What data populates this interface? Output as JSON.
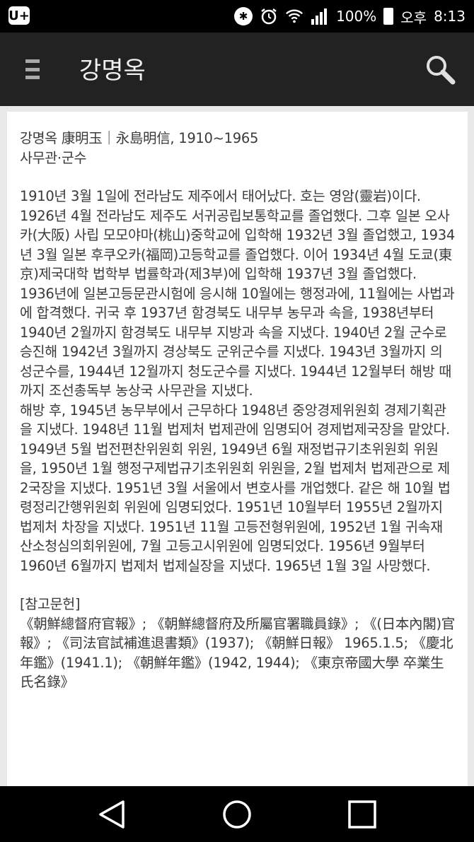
{
  "status_bar": {
    "app_badge": "U+",
    "battery": "100%",
    "ampm": "오후",
    "time": "8:13",
    "icons": [
      "bluetooth-icon",
      "alarm-icon",
      "wifi-icon",
      "signal-icon",
      "battery-icon"
    ]
  },
  "app_bar": {
    "title": "강명옥",
    "menu_icon": "hamburger-menu-icon",
    "search_icon": "search-icon",
    "background": "#222222"
  },
  "article": {
    "heading_line1": "강명옥 康明玉｜永島明信, 1910~1965",
    "heading_line2": "사무관·군수",
    "body_paragraph1": "1910년 3월 1일에 전라남도 제주에서 태어났다. 호는 영암(靈岩)이다. 1926년 4월 전라남도 제주도 서귀공립보통학교를 졸업했다. 그후 일본 오사카(大阪) 사립 모모야마(桃山)중학교에 입학해 1932년 3월 졸업했고, 1934년 3월 일본 후쿠오카(福岡)고등학교를 졸업했다. 이어 1934년 4월 도쿄(東京)제국대학 법학부 법률학과(제3부)에 입학해 1937년 3월 졸업했다. 1936년에 일본고등문관시험에 응시해 10월에는 행정과에, 11월에는 사법과에 합격했다. 귀국 후 1937년 함경북도 내무부 농무과 속을, 1938년부터 1940년 2월까지 함경북도 내무부 지방과 속을 지냈다. 1940년 2월 군수로 승진해 1942년 3월까지 경상북도 군위군수를 지냈다. 1943년 3월까지 의성군수를, 1944년 12월까지 청도군수를 지냈다. 1944년 12월부터 해방 때까지 조선총독부 농상국 사무관을 지냈다.",
    "body_paragraph2": "해방 후, 1945년 농무부에서 근무하다 1948년 중앙경제위원회 경제기획관을 지냈다. 1948년 11월 법제처 법제관에 임명되어 경제법제국장을 맡았다. 1949년 5월 법전편찬위원회 위원, 1949년 6월 재정법규기초위원회 위원을, 1950년 1월 행정구제법규기초위원회 위원을, 2월 법제처 법제관으로 제2국장을 지냈다. 1951년 3월 서울에서 변호사를 개업했다. 같은 해 10월 법령정리간행위원회 위원에 임명되었다. 1951년 10월부터 1955년 2월까지 법제처 차장을 지냈다. 1951년 11월 고등전형위원에, 1952년 1월 귀속재산소청심의회위원에, 7월 고등고시위원에 임명되었다. 1956년 9월부터 1960년 6월까지 법제처 법제실장을 지냈다. 1965년 1월 3일 사망했다.",
    "references_heading": "[참고문헌]",
    "references_text": "《朝鮮總督府官報》; 《朝鮮總督府及所屬官署職員錄》; 《(日本內閣)官報》; 《司法官試補進退書類》(1937); 《朝鮮日報》 1965.1.5; 《慶北年鑑》(1941.1); 《朝鮮年鑑》(1942, 1944); 《東京帝國大學 卒業生氏名錄》"
  },
  "nav_bar": {
    "back_icon": "back-triangle-icon",
    "home_icon": "home-circle-icon",
    "recents_icon": "recents-square-icon"
  }
}
